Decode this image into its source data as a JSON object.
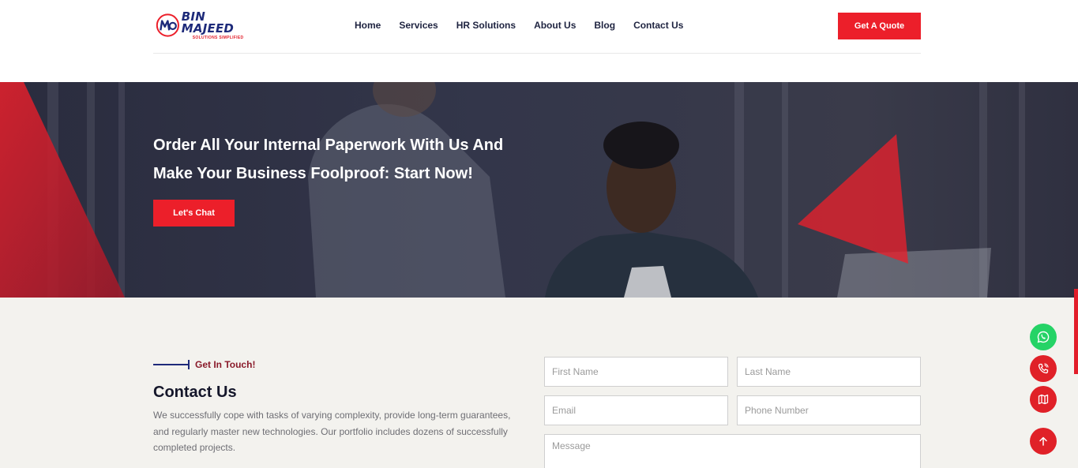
{
  "brand": {
    "name": "BIN MAJEED",
    "tagline": "SOLUTIONS SIMPLIFIED",
    "colors": {
      "red": "#ec1f2a",
      "navy": "#1d2a7a"
    }
  },
  "nav": {
    "items": [
      {
        "label": "Home"
      },
      {
        "label": "Services"
      },
      {
        "label": "HR Solutions"
      },
      {
        "label": "About Us"
      },
      {
        "label": "Blog"
      },
      {
        "label": "Contact Us"
      }
    ],
    "cta_label": "Get A Quote"
  },
  "hero": {
    "title_line1": "Order All Your Internal Paperwork With Us And",
    "title_line2": "Make Your Business Foolproof: Start Now!",
    "button_label": "Let's Chat"
  },
  "contact": {
    "kicker": "Get In Touch!",
    "title": "Contact Us",
    "description": "We successfully cope with tasks of varying complexity, provide long-term guarantees, and regularly master new technologies. Our portfolio includes dozens of successfully completed projects.",
    "form": {
      "first_name_placeholder": "First Name",
      "last_name_placeholder": "Last Name",
      "email_placeholder": "Email",
      "phone_placeholder": "Phone Number",
      "message_placeholder": "Message"
    }
  },
  "floating": {
    "icons": [
      "whatsapp-icon",
      "phone-icon",
      "map-icon",
      "arrow-up-icon"
    ]
  }
}
